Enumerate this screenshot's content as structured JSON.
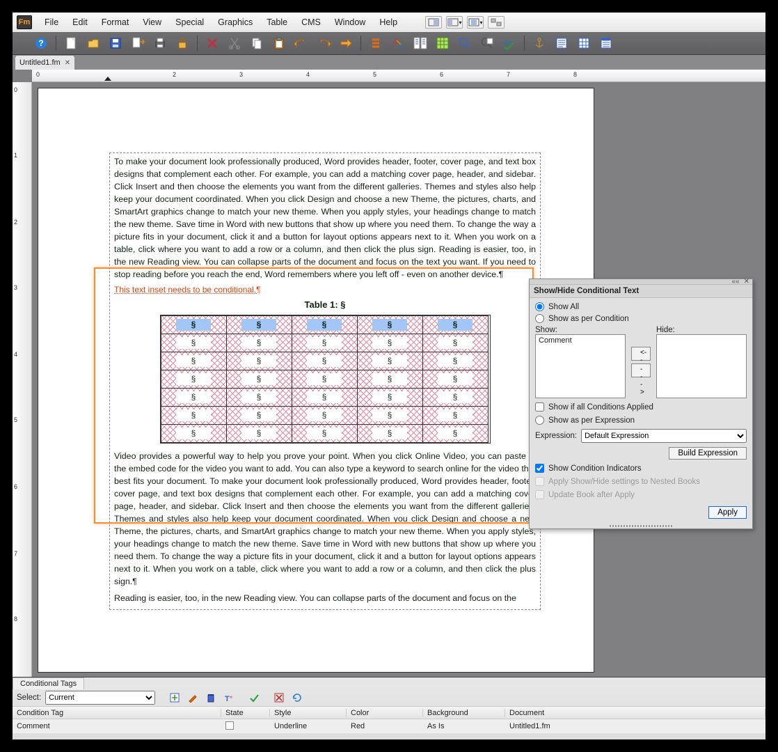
{
  "menu": {
    "items": [
      "File",
      "Edit",
      "Format",
      "View",
      "Special",
      "Graphics",
      "Table",
      "CMS",
      "Window",
      "Help"
    ]
  },
  "doc_tab": {
    "label": "Untitled1.fm"
  },
  "ruler": {
    "h": [
      "0",
      "1",
      "2",
      "3",
      "4",
      "5",
      "6",
      "7",
      "8"
    ],
    "v": [
      "0",
      "1",
      "2",
      "3",
      "4",
      "5",
      "6",
      "7",
      "8"
    ]
  },
  "doc": {
    "para1": "To make your document look professionally produced, Word provides header, footer, cover page, and text box designs that complement each other. For example, you can add a matching cover page, header, and sidebar. Click Insert and then choose the elements you want from the different galleries. Themes and styles also help keep your document coordinated. When you click Design and choose a new Theme, the pictures, charts, and SmartArt graphics change to match your new theme. When you apply styles, your headings change to match the new theme. Save time in Word with new buttons that show up where you need them. To change the way a picture fits in your document, click it and a button for layout options appears next to it. When you work on a table, click where you want to add a row or a column, and then click the plus sign. Reading is easier, too, in the new Reading view. You can collapse parts of the document and focus on the text you want. If you need to stop reading before you reach the end, Word remembers where you left off - even on another device.¶",
    "conditional_line": "This text inset needs to be conditional.¶",
    "table_caption": "Table 1: §",
    "para2": "Video provides a powerful way to help you prove your point. When you click Online Video, you can paste in the embed code for the video you want to add. You can also type a keyword to search online for the video that best fits your document. To make your document look professionally produced, Word provides header, footer, cover page, and text box designs that complement each other. For example, you can add a matching cover page, header, and sidebar. Click Insert and then choose the elements you want from the different galleries. Themes and styles also help keep your document coordinated. When you click Design and choose a new Theme, the pictures, charts, and SmartArt graphics change to match your new theme. When you apply styles, your headings change to match the new theme. Save time in Word with new buttons that show up where you need them. To change the way a picture fits in your document, click it and a button for layout options appears next to it. When you work on a table, click where you want to add a row or a column, and then click the plus sign.¶",
    "para3": "Reading is easier, too, in the new Reading view. You can collapse parts of the document and focus on the"
  },
  "panel": {
    "title": "Show/Hide Conditional Text",
    "radio1": "Show All",
    "radio2": "Show as per Condition",
    "show_hdr": "Show:",
    "hide_hdr": "Hide:",
    "show_list": [
      "Comment"
    ],
    "left_btn": "<---",
    "right_btn": "--->",
    "chk_showif": "Show if all Conditions Applied",
    "radio3": "Show as per Expression",
    "expr_lbl": "Expression:",
    "expr_value": "Default Expression",
    "build_btn": "Build Expression",
    "chk_indicators": "Show Condition Indicators",
    "nested": "Apply Show/Hide settings to Nested Books",
    "updatebk": "Update Book after Apply",
    "apply_btn": "Apply"
  },
  "bottom": {
    "tab": "Conditional Tags",
    "select_lbl": "Select:",
    "select_val": "Current",
    "headers": {
      "tag": "Condition Tag",
      "state": "State",
      "style": "Style",
      "color": "Color",
      "bg": "Background",
      "doc": "Document"
    },
    "row": {
      "tag": "Comment",
      "style": "Underline",
      "color": "Red",
      "bg": "As Is",
      "doc": "Untitled1.fm"
    }
  }
}
